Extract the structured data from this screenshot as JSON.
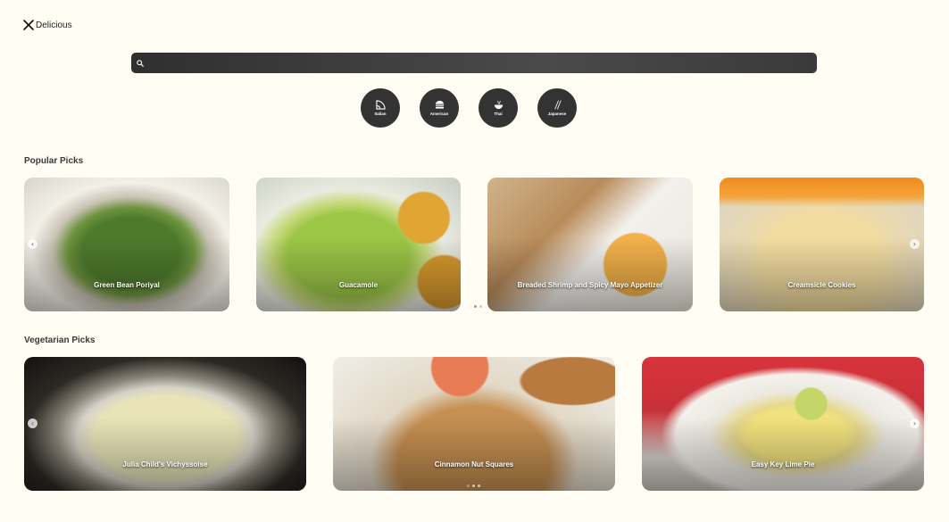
{
  "app": {
    "logo_text": "Delicious"
  },
  "search": {
    "placeholder": "",
    "value": ""
  },
  "cuisines": [
    {
      "label": "Italian",
      "icon": "pizza-icon"
    },
    {
      "label": "American",
      "icon": "burger-icon"
    },
    {
      "label": "Thai",
      "icon": "bowl-icon"
    },
    {
      "label": "Japanese",
      "icon": "chopsticks-icon"
    }
  ],
  "popular": {
    "title": "Popular Picks",
    "cards": [
      {
        "title": "Green Bean Poriyal"
      },
      {
        "title": "Guacamole"
      },
      {
        "title": "Breaded Shrimp and Spicy Mayo Appetizer"
      },
      {
        "title": "Creamsicle Cookies"
      }
    ]
  },
  "vegetarian": {
    "title": "Vegetarian Picks",
    "cards": [
      {
        "title": "Julia Child's Vichyssoise"
      },
      {
        "title": "Cinnamon Nut Squares"
      },
      {
        "title": "Easy Key Lime Pie"
      }
    ]
  },
  "colors": {
    "background": "#fffdf4",
    "pill": "#333333"
  }
}
